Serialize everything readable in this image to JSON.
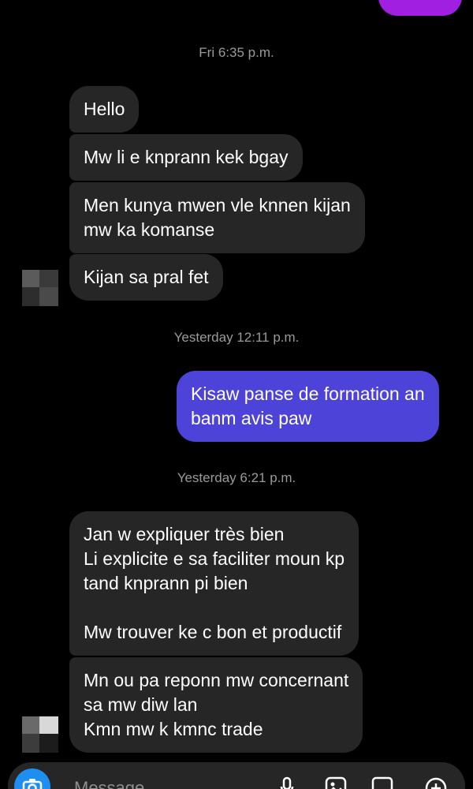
{
  "timestamps": {
    "fri": "Fri 6:35 p.m.",
    "yest1": "Yesterday 12:11 p.m.",
    "yest2": "Yesterday 6:21 p.m."
  },
  "messages": {
    "m1": "Hello",
    "m2": "Mw li e knprann kek bgay",
    "m3": "Men kunya mwen vle knnen kijan\nmw ka komanse",
    "m4": "Kijan sa pral fet",
    "m5": "Kisaw panse de formation an\nbanm avis paw",
    "m6": "Jan w expliquer très bien\nLi explicite e sa faciliter moun kp\ntand knprann pi bien\n\nMw trouver ke c bon et productif",
    "m7": "Mn ou pa reponn mw concernant\nsa mw diw lan\nKmn mw k kmnc trade"
  },
  "composer": {
    "placeholder": "Message..."
  },
  "colors": {
    "incoming": "#262626",
    "outgoing": "#4d43d9",
    "outgoing_top": "#a11fe0",
    "camera": "#1f8ef1"
  }
}
